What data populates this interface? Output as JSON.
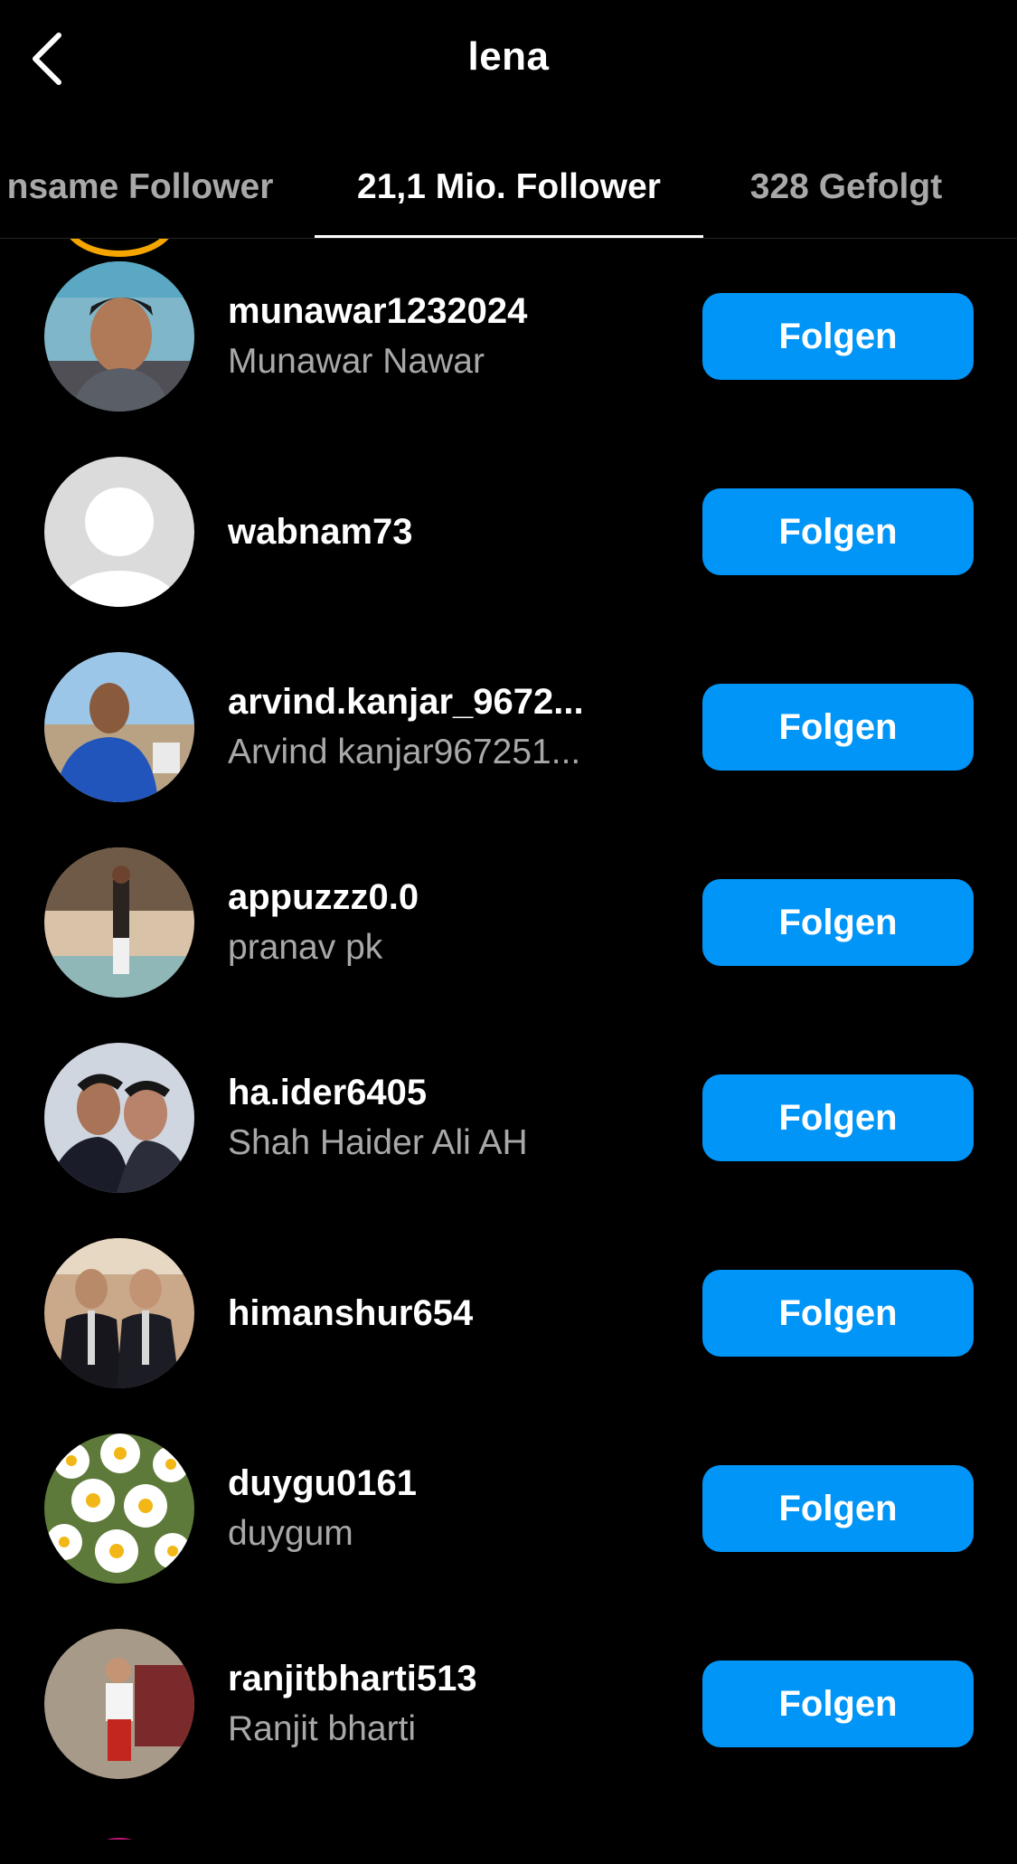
{
  "header": {
    "title": "lena",
    "back_icon": "chevron-left-icon"
  },
  "tabs": [
    {
      "label": "nsame Follower",
      "active": false
    },
    {
      "label": "21,1 Mio. Follower",
      "active": true
    },
    {
      "label": "328 Gefolgt",
      "active": false
    }
  ],
  "follow_label": "Folgen",
  "colors": {
    "background": "#000000",
    "follow_button": "#0095f6",
    "secondary_text": "#a8a8a8",
    "story_ring": "#f4a500"
  },
  "followers": [
    {
      "username": "munawar1232024",
      "full_name": "Munawar Nawar",
      "avatar": "user-photo-avatar"
    },
    {
      "username": "wabnam73",
      "full_name": "",
      "avatar": "default-avatar-icon"
    },
    {
      "username": "arvind.kanjar_9672...",
      "full_name": "Arvind kanjar967251...",
      "avatar": "user-photo-avatar"
    },
    {
      "username": "appuzzz0.0",
      "full_name": "pranav pk",
      "avatar": "user-photo-avatar"
    },
    {
      "username": "ha.ider6405",
      "full_name": "Shah Haider Ali AH",
      "avatar": "user-photo-avatar"
    },
    {
      "username": "himanshur654",
      "full_name": "",
      "avatar": "user-photo-avatar"
    },
    {
      "username": "duygu0161",
      "full_name": "duygum",
      "avatar": "flowers-photo-avatar"
    },
    {
      "username": "ranjitbharti513",
      "full_name": "Ranjit bharti",
      "avatar": "user-photo-avatar"
    }
  ]
}
